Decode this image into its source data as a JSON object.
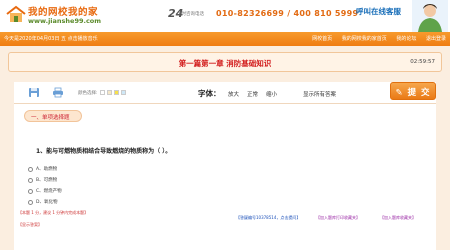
{
  "header": {
    "logo_title": "我的网校我的家",
    "logo_url": "www.jianshe99.com",
    "hotline_prefix": "24",
    "hotline_sub": "小时咨询电话",
    "hotline_numbers": "010-82326699 / 400 810 5999",
    "call_service": "呼叫在线客服"
  },
  "topbar": {
    "date": "今天是2020年04月03日  五 点击播放音乐",
    "nav": [
      "网校首页",
      "我的网校我的家首页",
      "我的论坛",
      "退出登录"
    ]
  },
  "exam": {
    "chapter_title": "第一篇第一章  消防基础知识",
    "timer": "02:59:57"
  },
  "toolbar": {
    "background_label": "颜色选择:",
    "swatches": [
      "#ffffff",
      "#f5e7c8",
      "#f7e04a",
      "#cfe8f7"
    ],
    "font_label": "字体：",
    "font_options": [
      "放大",
      "正常",
      "缩小"
    ],
    "show_answers": "显示所有答案",
    "submit_label": "提 交"
  },
  "content": {
    "section_label": "一、单项选择题",
    "question": "1、能与可燃物质相结合导致燃烧的物质称为（    ）。",
    "options": [
      "A、助燃物",
      "B、可燃物",
      "C、燃烧产物",
      "D、氧化物"
    ],
    "left_links": "【本题 1 分，建议 1 分钟内完成本题】",
    "show_answer": "【显示答案】",
    "right_links": [
      "【答疑编号10378514，点击提问】",
      "【加入题库打印收藏夹】",
      "【加入题库收藏夹】"
    ]
  },
  "colors": {
    "accent": "#ef7d12",
    "title_red": "#d21c1c",
    "link_blue": "#1a4fb9",
    "link_purple": "#9b2aa6"
  }
}
